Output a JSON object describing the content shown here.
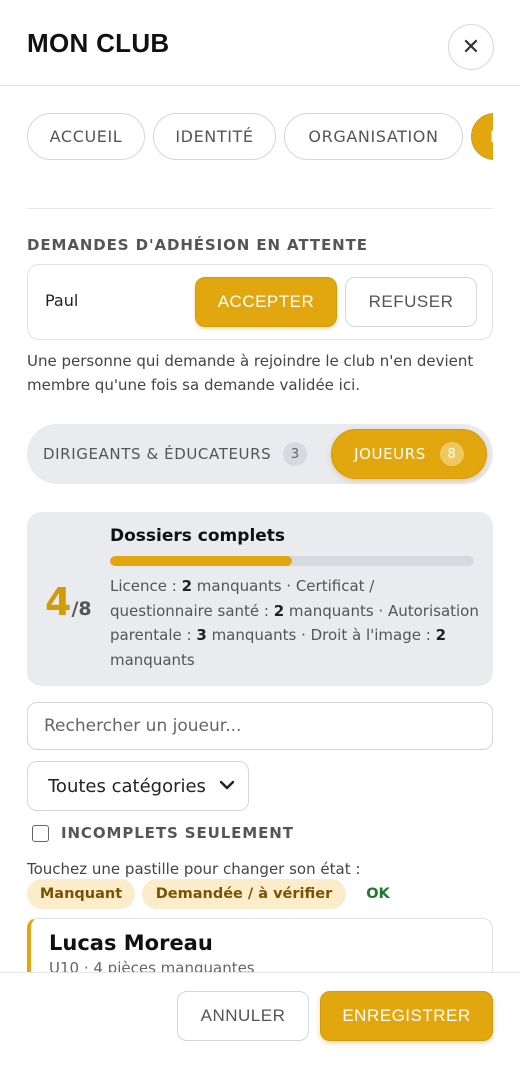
{
  "header": {
    "title": "MON CLUB",
    "close_icon": "close-icon"
  },
  "tabs": [
    {
      "label": "ACCUEIL",
      "active": false
    },
    {
      "label": "IDENTITÉ",
      "active": false
    },
    {
      "label": "ORGANISATION",
      "active": false
    },
    {
      "label": "MEMBRES",
      "active": true
    }
  ],
  "requests": {
    "section_label": "DEMANDES D'ADHÉSION EN ATTENTE",
    "items": [
      {
        "name": "Paul",
        "accept_label": "ACCEPTER",
        "refuse_label": "REFUSER"
      }
    ],
    "info": "Une personne qui demande à rejoindre le club n'en devient membre qu'une fois sa demande validée ici."
  },
  "segments": {
    "staff": {
      "label": "DIRIGEANTS & ÉDUCATEURS",
      "count": "3"
    },
    "players": {
      "label": "JOUEURS",
      "count": "8",
      "active": true
    }
  },
  "dossiers": {
    "title": "Dossiers complets",
    "complete": "4",
    "total": "/8",
    "progress_fraction": 0.5,
    "details": [
      {
        "label": "Licence : ",
        "value": "2",
        "suffix": " manquants · "
      },
      {
        "label": "Certificat / questionnaire santé : ",
        "value": "2",
        "suffix": " manquants · "
      },
      {
        "label": "Autorisation parentale : ",
        "value": "3",
        "suffix": " manquants · "
      },
      {
        "label": "Droit à l'image : ",
        "value": "2",
        "suffix": " manquants"
      }
    ]
  },
  "filters": {
    "search_placeholder": "Rechercher un joueur...",
    "category_selected": "Toutes catégories",
    "incomplete_label": "INCOMPLETS SEULEMENT",
    "incomplete_checked": false
  },
  "legend": {
    "hint": "Touchez une pastille pour changer son état :",
    "missing": "Manquant",
    "pending": "Demandée / à vérifier",
    "ok": "OK"
  },
  "players": [
    {
      "name": "Lucas Moreau",
      "subtitle": "U10 · 4 pièces manquantes"
    }
  ],
  "footer": {
    "cancel_label": "ANNULER",
    "save_label": "ENREGISTRER"
  },
  "colors": {
    "accent": "#e2a60f",
    "ok": "#1e7a2e",
    "pill_bg": "#fbeccb"
  }
}
